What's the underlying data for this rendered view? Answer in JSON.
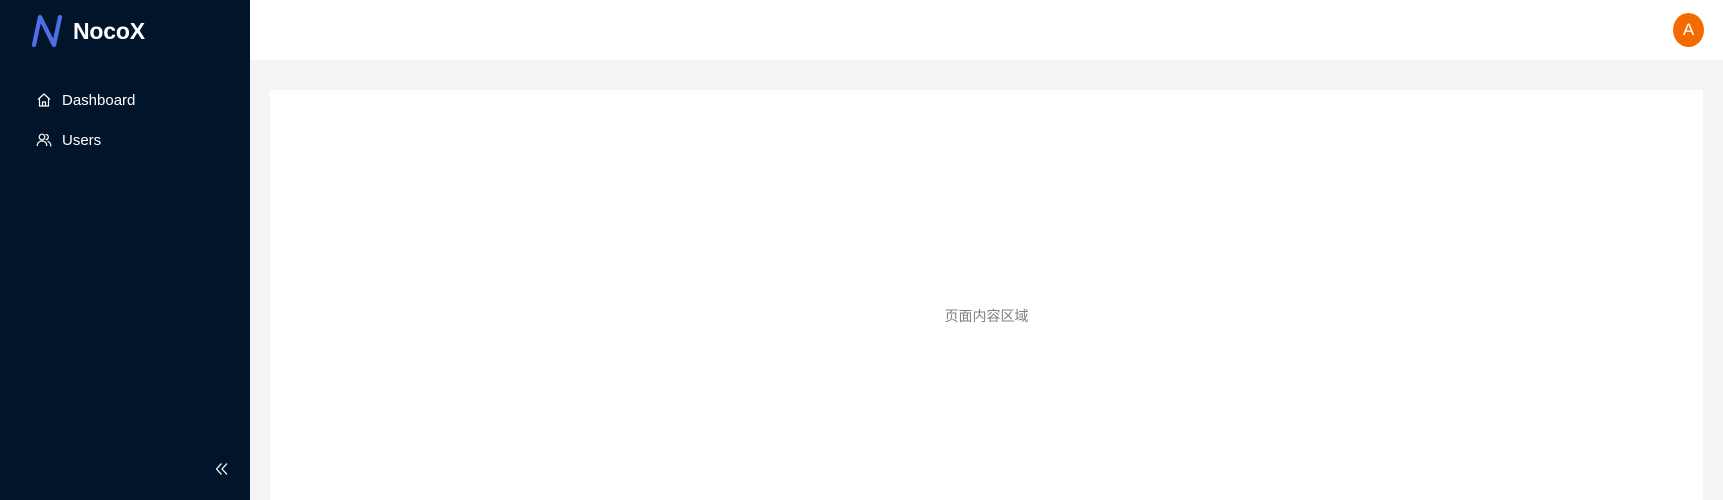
{
  "brand": {
    "name": "NocoX",
    "logo_icon": "nocox-logo-icon",
    "logo_color": "#4f6fe8"
  },
  "sidebar": {
    "background": "#001529",
    "items": [
      {
        "label": "Dashboard",
        "icon": "home-icon"
      },
      {
        "label": "Users",
        "icon": "users-icon"
      }
    ],
    "collapse_icon": "double-chevron-left-icon"
  },
  "header": {
    "avatar": {
      "initial": "A",
      "color": "#f56a00"
    }
  },
  "main": {
    "placeholder_text": "页面内容区域"
  }
}
